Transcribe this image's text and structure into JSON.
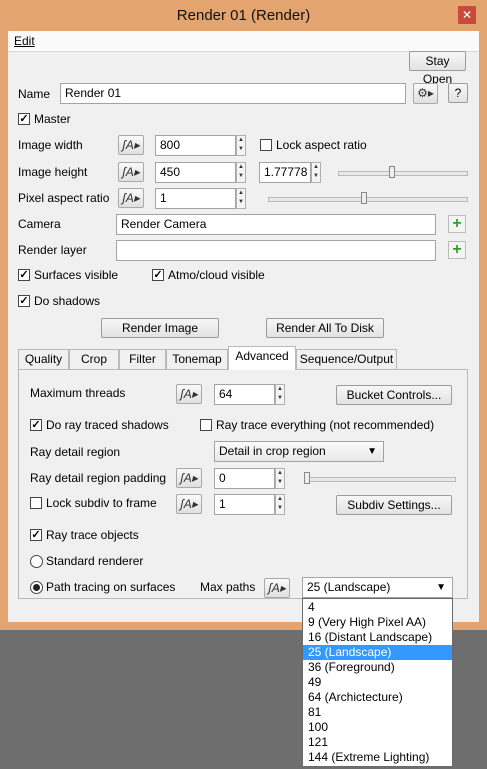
{
  "window": {
    "title": "Render 01    (Render)",
    "close_glyph": "✕"
  },
  "menu": {
    "edit": "Edit"
  },
  "buttons": {
    "stay_open": "Stay Open",
    "help": "?",
    "render_image": "Render Image",
    "render_all": "Render All To Disk",
    "bucket_controls": "Bucket Controls...",
    "subdiv_settings": "Subdiv Settings..."
  },
  "fields": {
    "name_label": "Name",
    "name_value": "Render 01",
    "master": "Master",
    "image_width_label": "Image width",
    "image_width_value": "800",
    "lock_aspect": "Lock aspect ratio",
    "image_height_label": "Image height",
    "image_height_value": "450",
    "aspect_value": "1.77778",
    "pixel_aspect_label": "Pixel aspect ratio",
    "pixel_aspect_value": "1",
    "camera_label": "Camera",
    "camera_value": "Render Camera",
    "render_layer_label": "Render layer",
    "render_layer_value": "",
    "surfaces_visible": "Surfaces visible",
    "atmo_visible": "Atmo/cloud visible",
    "do_shadows": "Do shadows"
  },
  "tabs": [
    "Quality",
    "Crop",
    "Filter",
    "Tonemap",
    "Advanced",
    "Sequence/Output"
  ],
  "active_tab": "Advanced",
  "advanced": {
    "max_threads_label": "Maximum threads",
    "max_threads_value": "64",
    "do_ray_traced_shadows": "Do ray traced shadows",
    "ray_trace_everything": "Ray trace everything (not recommended)",
    "ray_detail_region_label": "Ray detail region",
    "ray_detail_region_value": "Detail in crop region",
    "ray_detail_padding_label": "Ray detail region padding",
    "ray_detail_padding_value": "0",
    "lock_subdiv": "Lock subdiv to frame",
    "lock_subdiv_value": "1",
    "ray_trace_objects": "Ray trace objects",
    "standard_renderer": "Standard renderer",
    "path_tracing": "Path tracing on surfaces",
    "max_paths_label": "Max paths",
    "max_paths_value": "25 (Landscape)"
  },
  "max_paths_options": [
    "4",
    "9 (Very High Pixel AA)",
    "16 (Distant Landscape)",
    "25 (Landscape)",
    "36 (Foreground)",
    "49",
    "64 (Archictecture)",
    "81",
    "100",
    "121",
    "144 (Extreme Lighting)"
  ],
  "selected_option_index": 3,
  "colors": {
    "window_frame": "#e3a470",
    "selection": "#3399ff",
    "add_green": "#2ea02e"
  }
}
